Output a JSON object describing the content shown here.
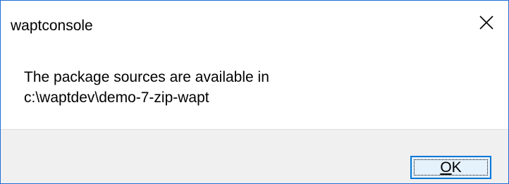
{
  "window": {
    "title": "waptconsole",
    "close_icon": "close-icon",
    "accent_color": "#1e6fd6"
  },
  "message": {
    "line1": "The package sources are available in",
    "line2": "c:\\waptdev\\demo-7-zip-wapt"
  },
  "buttons": {
    "ok_accel": "O",
    "ok_rest": "K"
  }
}
